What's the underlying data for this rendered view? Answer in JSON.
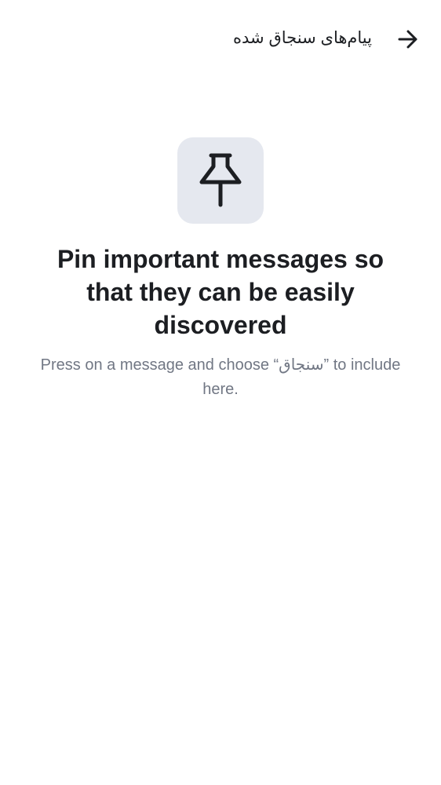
{
  "header": {
    "title": "پیام‌های سنجاق شده",
    "back_icon": "arrow-right-icon"
  },
  "empty_state": {
    "icon": "pin-icon",
    "title": "Pin important messages so that they can be easily discovered",
    "description": "Press on a message and choose “سنجاق” to include here."
  },
  "colors": {
    "tile_background": "#e5e8ef",
    "title_text": "#1c1e22",
    "description_text": "#717784"
  }
}
